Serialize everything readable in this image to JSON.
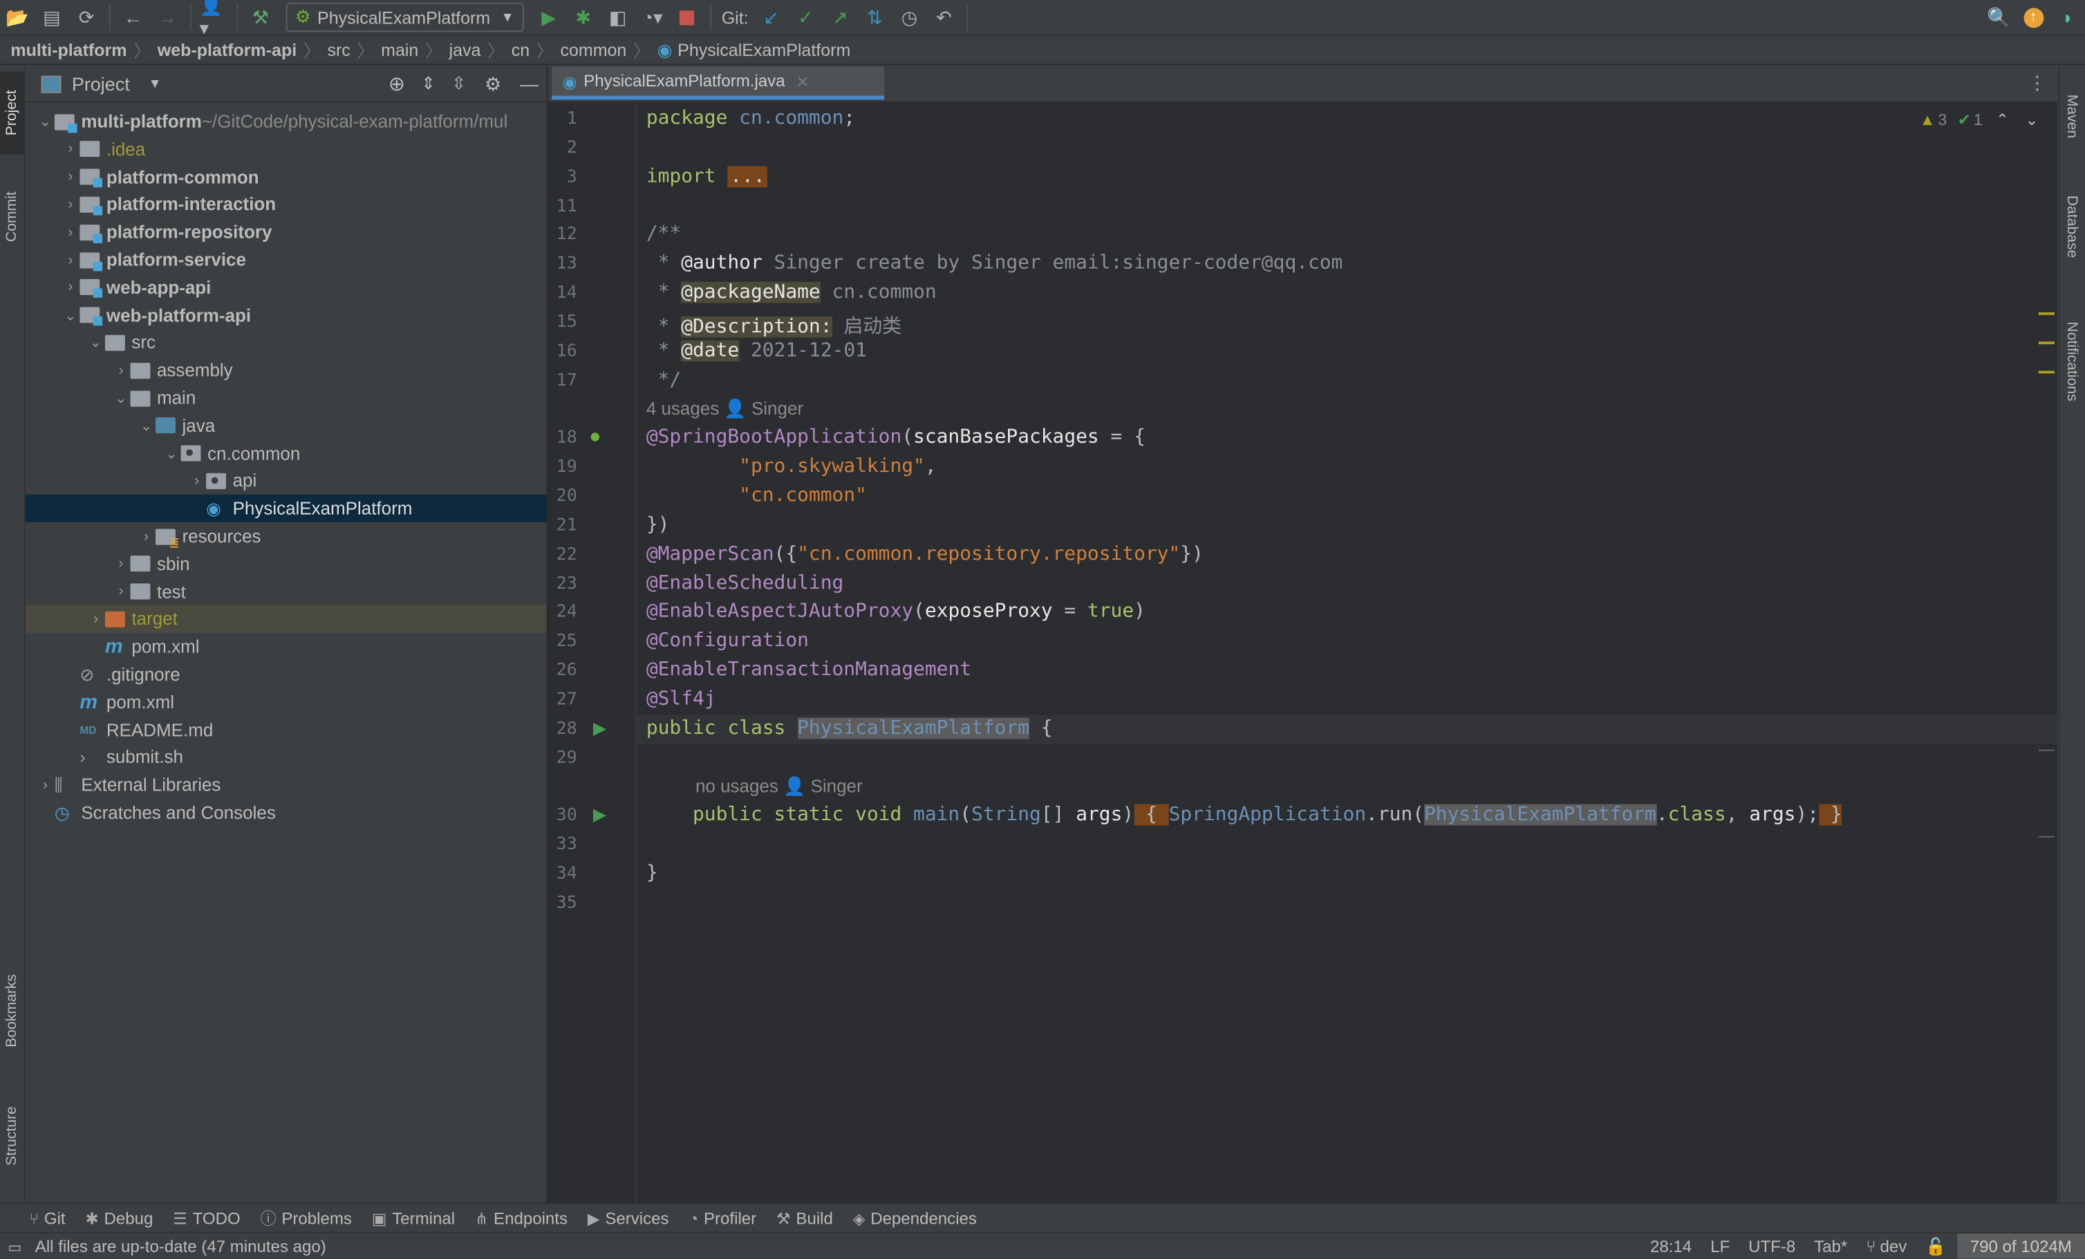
{
  "toolbar": {
    "run_config": "PhysicalExamPlatform",
    "git_label": "Git:",
    "icons": [
      "open-icon",
      "save-icon",
      "sync-icon",
      "back-icon",
      "forward-icon",
      "user-icon",
      "build-hammer-icon",
      "run-icon",
      "debug-icon",
      "coverage-icon",
      "profile-icon",
      "stop-icon",
      "git-update-icon",
      "git-commit-icon",
      "git-push-icon",
      "git-pull-icon",
      "history-icon",
      "rollback-icon",
      "search-icon",
      "updates-icon",
      "toolbox-icon"
    ]
  },
  "breadcrumb": [
    "multi-platform",
    "web-platform-api",
    "src",
    "main",
    "java",
    "cn",
    "common",
    "PhysicalExamPlatform"
  ],
  "left_strip": {
    "tabs": [
      "Project",
      "Commit",
      "Bookmarks",
      "Structure"
    ]
  },
  "right_strip": {
    "tabs": [
      "Maven",
      "Database",
      "Notifications"
    ]
  },
  "project_panel": {
    "title": "Project",
    "tree": [
      {
        "label": "multi-platform",
        "suffix": " ~/GitCode/physical-exam-platform/mul",
        "depth": 0,
        "chev": "v",
        "icon": "mod",
        "bold": true
      },
      {
        "label": ".idea",
        "depth": 1,
        "chev": ">",
        "icon": "plain",
        "color": "#9c9c3a"
      },
      {
        "label": "platform-common",
        "depth": 1,
        "chev": ">",
        "icon": "mod",
        "bold": true
      },
      {
        "label": "platform-interaction",
        "depth": 1,
        "chev": ">",
        "icon": "mod",
        "bold": true
      },
      {
        "label": "platform-repository",
        "depth": 1,
        "chev": ">",
        "icon": "mod",
        "bold": true
      },
      {
        "label": "platform-service",
        "depth": 1,
        "chev": ">",
        "icon": "mod",
        "bold": true
      },
      {
        "label": "web-app-api",
        "depth": 1,
        "chev": ">",
        "icon": "mod",
        "bold": true
      },
      {
        "label": "web-platform-api",
        "depth": 1,
        "chev": "v",
        "icon": "mod",
        "bold": true
      },
      {
        "label": "src",
        "depth": 2,
        "chev": "v",
        "icon": "plain"
      },
      {
        "label": "assembly",
        "depth": 3,
        "chev": ">",
        "icon": "plain"
      },
      {
        "label": "main",
        "depth": 3,
        "chev": "v",
        "icon": "plain"
      },
      {
        "label": "java",
        "depth": 4,
        "chev": "v",
        "icon": "blue"
      },
      {
        "label": "cn.common",
        "depth": 5,
        "chev": "v",
        "icon": "pkg"
      },
      {
        "label": "api",
        "depth": 6,
        "chev": ">",
        "icon": "pkg"
      },
      {
        "label": "PhysicalExamPlatform",
        "depth": 6,
        "chev": "",
        "icon": "spring",
        "selected": true
      },
      {
        "label": "resources",
        "depth": 4,
        "chev": ">",
        "icon": "res"
      },
      {
        "label": "sbin",
        "depth": 3,
        "chev": ">",
        "icon": "plain"
      },
      {
        "label": "test",
        "depth": 3,
        "chev": ">",
        "icon": "plain"
      },
      {
        "label": "target",
        "depth": 2,
        "chev": ">",
        "icon": "orange",
        "color": "#9c9c3a",
        "excluded": true
      },
      {
        "label": "pom.xml",
        "depth": 2,
        "chev": "",
        "icon": "maven"
      },
      {
        "label": ".gitignore",
        "depth": 1,
        "chev": "",
        "icon": "ignore"
      },
      {
        "label": "pom.xml",
        "depth": 1,
        "chev": "",
        "icon": "maven"
      },
      {
        "label": "README.md",
        "depth": 1,
        "chev": "",
        "icon": "md"
      },
      {
        "label": "submit.sh",
        "depth": 1,
        "chev": "",
        "icon": "shell"
      },
      {
        "label": "External Libraries",
        "depth": 0,
        "chev": ">",
        "icon": "libs"
      },
      {
        "label": "Scratches and Consoles",
        "depth": 0,
        "chev": "",
        "icon": "scratch"
      }
    ]
  },
  "editor": {
    "tab_label": "PhysicalExamPlatform.java",
    "inspections": {
      "warnings": "3",
      "typos": "1"
    },
    "lines": [
      {
        "n": "1",
        "html": "<span class='kw'>package</span> <span class='pk'>cn.common</span>;"
      },
      {
        "n": "2",
        "html": ""
      },
      {
        "n": "3",
        "html": "<span class='kw'>import</span> <span class='fold-ph'>...</span>"
      },
      {
        "n": "11",
        "html": ""
      },
      {
        "n": "12",
        "html": "<span class='cm'>/**</span>"
      },
      {
        "n": "13",
        "html": "<span class='cm'> * </span><span class='tagn'>@author</span><span class='cm'> Singer create by Singer email:singer-coder@qq.com</span>"
      },
      {
        "n": "14",
        "html": "<span class='cm'> * </span><span class='tag'>@packageName</span><span class='cm'> cn.common</span>"
      },
      {
        "n": "15",
        "html": "<span class='cm'> * </span><span class='tag'>@Description:</span><span class='cm'> 启动类</span>"
      },
      {
        "n": "16",
        "html": "<span class='cm'> * </span><span class='tag'>@date</span><span class='cm'> 2021-12-01</span>"
      },
      {
        "n": "17",
        "html": "<span class='cm'> */</span>"
      },
      {
        "hint": "4 usages   👤 Singer",
        "indent": 0
      },
      {
        "n": "18",
        "html": "<span class='an'>@SpringBootApplication</span>(<span class='pl'>scanBasePackages</span> = {"
      },
      {
        "n": "19",
        "html": "        <span class='st'>\"pro.skywalking\"</span>,"
      },
      {
        "n": "20",
        "html": "        <span class='st'>\"cn.common\"</span>"
      },
      {
        "n": "21",
        "html": "})"
      },
      {
        "n": "22",
        "html": "<span class='an'>@MapperScan</span>({<span class='st'>\"cn.common.repository.repository\"</span>})"
      },
      {
        "n": "23",
        "html": "<span class='an'>@EnableScheduling</span>"
      },
      {
        "n": "24",
        "html": "<span class='an'>@EnableAspectJAutoProxy</span>(<span class='pl'>exposeProxy</span> = <span class='kw'>true</span>)"
      },
      {
        "n": "25",
        "html": "<span class='an'>@Configuration</span>"
      },
      {
        "n": "26",
        "html": "<span class='an'>@EnableTransactionManagement</span>"
      },
      {
        "n": "27",
        "html": "<span class='an'>@Slf4j</span>"
      },
      {
        "n": "28",
        "html": "<span class='kw'>public class</span> <span class='pk hl'>PhysicalExamPlatform</span> {",
        "current": true
      },
      {
        "n": "29",
        "html": ""
      },
      {
        "hint": "no usages   👤 Singer",
        "indent": 1
      },
      {
        "n": "30",
        "html": "    <span class='kw'>public static void</span> <span class='pk'>main</span>(<span class='pk'>String</span>[] <span class='pl'>args</span>)<span class='brh'> { </span><span class='pk'>SpringApplication</span>.run(<span class='pk hl'>PhysicalExamPlatform</span>.<span class='kw'>class</span>, <span class='pl'>args</span>);<span class='brh'> }</span>"
      },
      {
        "n": "33",
        "html": ""
      },
      {
        "n": "34",
        "html": "}"
      },
      {
        "n": "35",
        "html": ""
      }
    ]
  },
  "tool_tabs": [
    {
      "label": "Git",
      "icon": "git-branch-icon",
      "glyph": "⑂"
    },
    {
      "label": "Debug",
      "icon": "debug-icon",
      "glyph": "✱"
    },
    {
      "label": "TODO",
      "icon": "todo-list-icon",
      "glyph": "☰"
    },
    {
      "label": "Problems",
      "icon": "problems-icon",
      "glyph": "ⓘ"
    },
    {
      "label": "Terminal",
      "icon": "terminal-icon",
      "glyph": "▣"
    },
    {
      "label": "Endpoints",
      "icon": "endpoints-icon",
      "glyph": "⋔"
    },
    {
      "label": "Services",
      "icon": "services-icon",
      "glyph": "▶"
    },
    {
      "label": "Profiler",
      "icon": "profiler-icon",
      "glyph": "◔"
    },
    {
      "label": "Build",
      "icon": "build-icon",
      "glyph": "⚒"
    },
    {
      "label": "Dependencies",
      "icon": "dependencies-icon",
      "glyph": "◈"
    }
  ],
  "status": {
    "message": "All files are up-to-date (47 minutes ago)",
    "position": "28:14",
    "line_sep": "LF",
    "encoding": "UTF-8",
    "indent": "Tab*",
    "branch": "dev",
    "memory": "790 of 1024M",
    "memory_fraction": 0.77
  }
}
